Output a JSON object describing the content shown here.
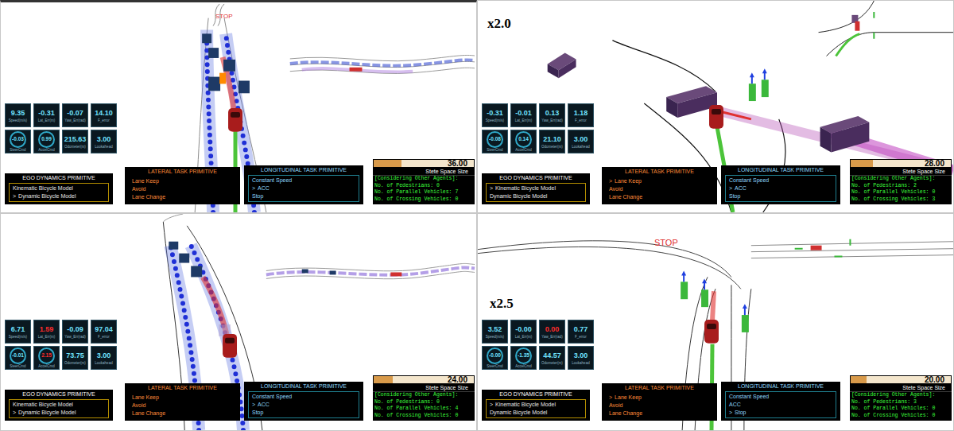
{
  "selection_marker": ">",
  "panels": [
    {
      "stop_label": "STOP",
      "gauges": [
        {
          "value": "9.35",
          "label": "Speed(m/s)",
          "kind": "tile",
          "alert": false
        },
        {
          "value": "-0.31",
          "label": "Lat_Err(m)",
          "kind": "tile",
          "alert": false
        },
        {
          "value": "-0.07",
          "label": "Yaw_Err(rad)",
          "kind": "tile",
          "alert": false
        },
        {
          "value": "14.10",
          "label": "F_error",
          "kind": "tile",
          "alert": false
        },
        {
          "value": "-0.03",
          "label": "SteerCmd",
          "kind": "dial",
          "alert": false
        },
        {
          "value": "0.99",
          "label": "AccelCmd",
          "kind": "dial",
          "alert": false
        },
        {
          "value": "215.63",
          "label": "Odometer(m)",
          "kind": "tile",
          "alert": false
        },
        {
          "value": "3.00",
          "label": "Lookahead",
          "kind": "tile",
          "alert": false
        }
      ],
      "ego": {
        "title": "EGO DYNAMICS PRIMITIVE",
        "items": [
          {
            "label": "Kinematic Bicycle Model",
            "selected": false
          },
          {
            "label": "Dynamic Bicycle Model",
            "selected": true
          }
        ]
      },
      "lateral": {
        "title": "LATERAL TASK PRIMITIVE",
        "items": [
          {
            "label": "Lane Keep",
            "selected": false
          },
          {
            "label": "Avoid",
            "selected": false
          },
          {
            "label": "Lane Change",
            "selected": false
          }
        ]
      },
      "longitudinal": {
        "title": "LONGITUDINAL TASK PRIMITIVE",
        "items": [
          {
            "label": "Constant Speed",
            "selected": false
          },
          {
            "label": "ACC",
            "selected": true
          },
          {
            "label": "Stop",
            "selected": false
          }
        ]
      },
      "state": {
        "value": "36.00",
        "label": "Stete Space Size",
        "level": 0.28,
        "heading": "[Considering Other Agents]:",
        "lines": [
          "No. of Pedestrians: 0",
          "No. of Parallel Vehicles: 7",
          "No. of Crossing Vehicles: 0"
        ]
      }
    },
    {
      "speed_multiplier": "x2.0",
      "gauges": [
        {
          "value": "-0.31",
          "label": "Speed(m/s)",
          "kind": "tile",
          "alert": false
        },
        {
          "value": "-0.01",
          "label": "Lat_Err(m)",
          "kind": "tile",
          "alert": false
        },
        {
          "value": "0.13",
          "label": "Yaw_Err(rad)",
          "kind": "tile",
          "alert": false
        },
        {
          "value": "1.18",
          "label": "F_error",
          "kind": "tile",
          "alert": false
        },
        {
          "value": "-0.08",
          "label": "SteerCmd",
          "kind": "dial",
          "alert": false
        },
        {
          "value": "0.14",
          "label": "AccelCmd",
          "kind": "dial",
          "alert": false
        },
        {
          "value": "21.10",
          "label": "Odometer(m)",
          "kind": "tile",
          "alert": false
        },
        {
          "value": "3.00",
          "label": "Lookahead",
          "kind": "tile",
          "alert": false
        }
      ],
      "ego": {
        "title": "EGO DYNAMICS PRIMITIVE",
        "items": [
          {
            "label": "Kinematic Bicycle Model",
            "selected": true
          },
          {
            "label": "Dynamic Bicycle Model",
            "selected": false
          }
        ]
      },
      "lateral": {
        "title": "LATERAL TASK PRIMITIVE",
        "items": [
          {
            "label": "Lane Keep",
            "selected": true
          },
          {
            "label": "Avoid",
            "selected": false
          },
          {
            "label": "Lane Change",
            "selected": false
          }
        ]
      },
      "longitudinal": {
        "title": "LONGITUDINAL TASK PRIMITIVE",
        "items": [
          {
            "label": "Constant Speed",
            "selected": false
          },
          {
            "label": "ACC",
            "selected": true
          },
          {
            "label": "Stop",
            "selected": false
          }
        ]
      },
      "state": {
        "value": "28.00",
        "label": "Stete Space Size",
        "level": 0.22,
        "heading": "[Considering Other Agents]:",
        "lines": [
          "No. of Pedestrians: 2",
          "No. of Parallel Vehicles: 0",
          "No. of Crossing Vehicles: 3"
        ]
      }
    },
    {
      "gauges": [
        {
          "value": "6.71",
          "label": "Speed(m/s)",
          "kind": "tile",
          "alert": false
        },
        {
          "value": "1.59",
          "label": "Lat_Err(m)",
          "kind": "tile",
          "alert": true
        },
        {
          "value": "-0.09",
          "label": "Yaw_Err(rad)",
          "kind": "tile",
          "alert": false
        },
        {
          "value": "97.04",
          "label": "F_error",
          "kind": "tile",
          "alert": false
        },
        {
          "value": "-0.01",
          "label": "SteerCmd",
          "kind": "dial",
          "alert": false
        },
        {
          "value": "2.15",
          "label": "AccelCmd",
          "kind": "dial",
          "alert": true
        },
        {
          "value": "73.75",
          "label": "Odometer(m)",
          "kind": "tile",
          "alert": false
        },
        {
          "value": "3.00",
          "label": "Lookahead",
          "kind": "tile",
          "alert": false
        }
      ],
      "ego": {
        "title": "EGO DYNAMICS PRIMITIVE",
        "items": [
          {
            "label": "Kinematic Bicycle Model",
            "selected": false
          },
          {
            "label": "Dynamic Bicycle Model",
            "selected": true
          }
        ]
      },
      "lateral": {
        "title": "LATERAL TASK PRIMITIVE",
        "items": [
          {
            "label": "Lane Keep",
            "selected": false
          },
          {
            "label": "Avoid",
            "selected": false
          },
          {
            "label": "Lane Change",
            "selected": false
          }
        ]
      },
      "longitudinal": {
        "title": "LONGITUDINAL TASK PRIMITIVE",
        "items": [
          {
            "label": "Constant Speed",
            "selected": false
          },
          {
            "label": "ACC",
            "selected": true
          },
          {
            "label": "Stop",
            "selected": false
          }
        ]
      },
      "state": {
        "value": "24.00",
        "label": "Stete Space Size",
        "level": 0.19,
        "heading": "[Considering Other Agents]:",
        "lines": [
          "No. of Pedestrians: 0",
          "No. of Parallel Vehicles: 4",
          "No. of Crossing Vehicles: 0"
        ]
      }
    },
    {
      "stop_label": "STOP",
      "speed_multiplier": "x2.5",
      "gauges": [
        {
          "value": "3.52",
          "label": "Speed(m/s)",
          "kind": "tile",
          "alert": false
        },
        {
          "value": "-0.00",
          "label": "Lat_Err(m)",
          "kind": "tile",
          "alert": false
        },
        {
          "value": "0.00",
          "label": "Yaw_Err(rad)",
          "kind": "tile",
          "alert": true
        },
        {
          "value": "0.77",
          "label": "F_error",
          "kind": "tile",
          "alert": false
        },
        {
          "value": "-0.00",
          "label": "SteerCmd",
          "kind": "dial",
          "alert": false
        },
        {
          "value": "-1.35",
          "label": "AccelCmd",
          "kind": "dial",
          "alert": false
        },
        {
          "value": "44.57",
          "label": "Odometer(m)",
          "kind": "tile",
          "alert": false
        },
        {
          "value": "3.00",
          "label": "Lookahead",
          "kind": "tile",
          "alert": false
        }
      ],
      "ego": {
        "title": "EGO DYNAMICS PRIMITIVE",
        "items": [
          {
            "label": "Kinematic Bicycle Model",
            "selected": true
          },
          {
            "label": "Dynamic Bicycle Model",
            "selected": false
          }
        ]
      },
      "lateral": {
        "title": "LATERAL TASK PRIMITIVE",
        "items": [
          {
            "label": "Lane Keep",
            "selected": true
          },
          {
            "label": "Avoid",
            "selected": false
          },
          {
            "label": "Lane Change",
            "selected": false
          }
        ]
      },
      "longitudinal": {
        "title": "LONGITUDINAL TASK PRIMITIVE",
        "items": [
          {
            "label": "Constant Speed",
            "selected": false
          },
          {
            "label": "ACC",
            "selected": false
          },
          {
            "label": "Stop",
            "selected": true
          }
        ]
      },
      "state": {
        "value": "20.00",
        "label": "Stete Space Size",
        "level": 0.16,
        "heading": "[Considering Other Agents]:",
        "lines": [
          "No. of Pedestrians: 3",
          "No. of Parallel Vehicles: 0",
          "No. of Crossing Vehicles: 0"
        ]
      }
    }
  ]
}
